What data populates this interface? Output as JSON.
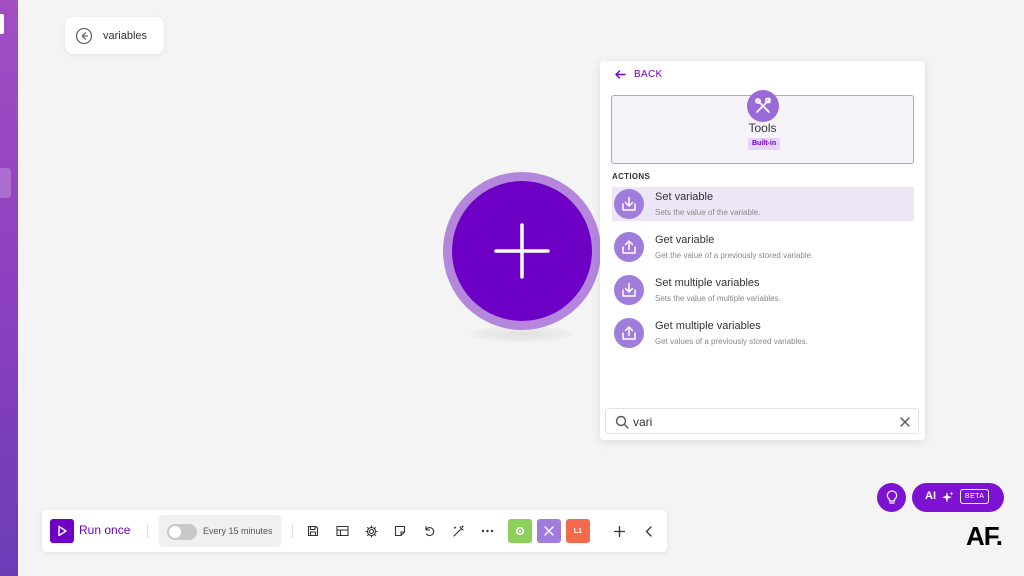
{
  "search_chip": {
    "label": "variables"
  },
  "panel": {
    "back_label": "BACK",
    "app": {
      "name": "Tools",
      "badge": "Built-in"
    },
    "section_label": "ACTIONS",
    "actions": [
      {
        "title": "Set variable",
        "subtitle": "Sets the value of the variable."
      },
      {
        "title": "Get variable",
        "subtitle": "Get the value of a previously stored variable."
      },
      {
        "title": "Set multiple variables",
        "subtitle": "Sets the value of multiple variables."
      },
      {
        "title": "Get multiple variables",
        "subtitle": "Get values of a previously stored variables."
      }
    ],
    "search": {
      "value": "vari"
    }
  },
  "toolbar": {
    "run_label": "Run once",
    "schedule_label": "Every 15 minutes",
    "module_orange_label": "L1"
  },
  "ai": {
    "label": "AI",
    "beta": "BETA"
  },
  "logo": {
    "text": "AF."
  },
  "colors": {
    "brand": "#6e00c5",
    "halo": "#b487dc",
    "module_green": "#8ccf5b",
    "module_purple": "#a07ddc",
    "module_orange": "#f26b4c"
  },
  "icons": {
    "chip": "arrow-left-circle-icon",
    "canvas": "plus-icon",
    "app": "tools-icon",
    "set_action": "download-tray-icon",
    "get_action": "upload-tray-icon",
    "search": "search-icon",
    "clear": "close-icon"
  }
}
